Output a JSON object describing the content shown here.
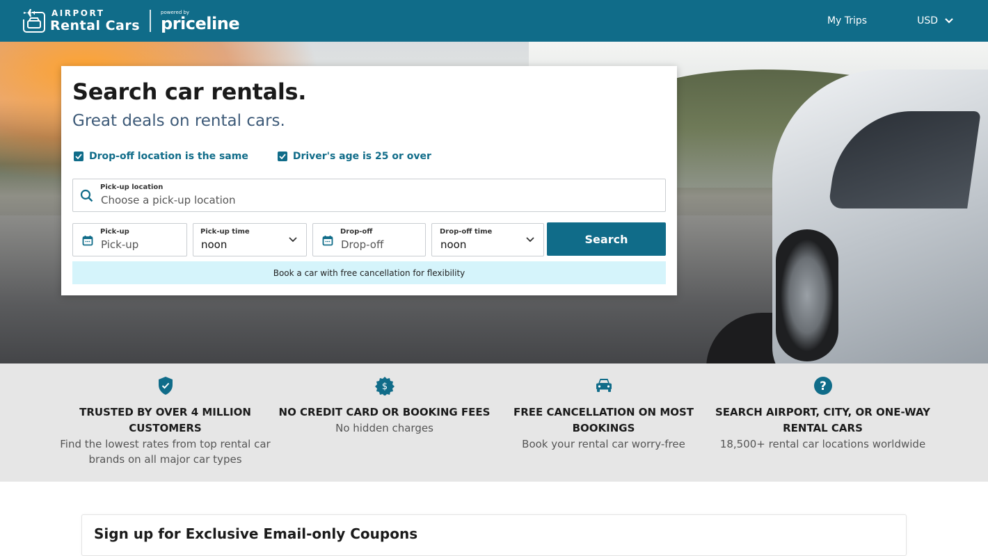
{
  "header": {
    "logo_small": "AIRPORT",
    "logo_big": "Rental Cars",
    "powered_by": "powered by",
    "partner": "priceline",
    "nav": [
      {
        "label": "My Trips"
      },
      {
        "label": "USD",
        "icon": "chevron-down-icon"
      }
    ]
  },
  "colors": {
    "brand": "#106c89",
    "subtitle": "#3d5a78",
    "banner_bg": "#d5f4fb",
    "features_bg": "#e6e6e6"
  },
  "search_card": {
    "title": "Search car rentals.",
    "subtitle": "Great deals on rental cars.",
    "checkboxes": [
      {
        "label": "Drop-off location is the same",
        "checked": true
      },
      {
        "label": "Driver's age is 25 or over",
        "checked": true
      }
    ],
    "pickup_location": {
      "label": "Pick-up location",
      "placeholder": "Choose a pick-up location",
      "icon": "search-icon"
    },
    "pickup_date": {
      "label": "Pick-up",
      "placeholder": "Pick-up",
      "icon": "calendar-icon"
    },
    "pickup_time": {
      "label": "Pick-up time",
      "value": "noon"
    },
    "dropoff_date": {
      "label": "Drop-off",
      "placeholder": "Drop-off",
      "icon": "calendar-icon"
    },
    "dropoff_time": {
      "label": "Drop-off time",
      "value": "noon"
    },
    "search_button": "Search",
    "banner": "Book a car with free cancellation for flexibility"
  },
  "features": [
    {
      "icon": "shield-check-icon",
      "title": "TRUSTED BY OVER 4 MILLION CUSTOMERS",
      "desc": "Find the lowest rates from top rental car brands on all major car types"
    },
    {
      "icon": "dollar-badge-icon",
      "title": "NO CREDIT CARD OR BOOKING FEES",
      "desc": "No hidden charges"
    },
    {
      "icon": "car-icon",
      "title": "FREE CANCELLATION ON MOST BOOKINGS",
      "desc": "Book your rental car worry-free"
    },
    {
      "icon": "question-circle-icon",
      "title": "SEARCH AIRPORT, CITY, OR ONE-WAY RENTAL CARS",
      "desc": "18,500+ rental car locations worldwide"
    }
  ],
  "signup": {
    "title": "Sign up for Exclusive Email-only Coupons"
  }
}
